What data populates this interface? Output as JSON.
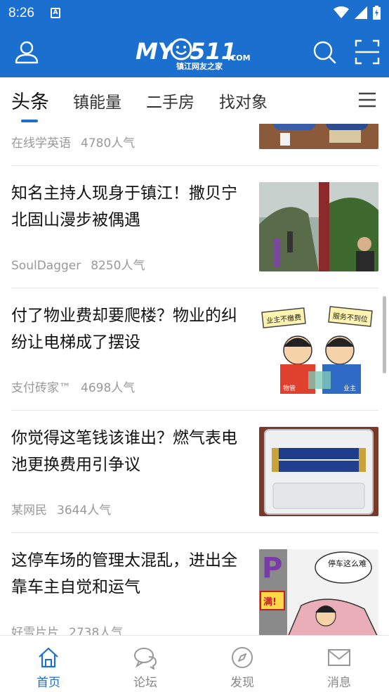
{
  "status_bar": {
    "time": "8:26",
    "notif_letter": "A"
  },
  "header": {
    "logo_main": "MY0511",
    "logo_com": ".COM",
    "logo_sub": "镇江网友之家",
    "profile_icon": "user-icon",
    "search_icon": "search-icon",
    "scan_icon": "scan-icon"
  },
  "tabs": [
    {
      "label": "头条",
      "active": true
    },
    {
      "label": "镇能量"
    },
    {
      "label": "二手房"
    },
    {
      "label": "找对象"
    }
  ],
  "feed": [
    {
      "title": "",
      "author": "在线学英语",
      "popularity": "4780人气",
      "image": "people-at-counter"
    },
    {
      "title": "知名主持人现身于镇江！撒贝宁北固山漫步被偶遇",
      "author": "SoulDagger",
      "popularity": "8250人气",
      "image": "man-on-path"
    },
    {
      "title": "付了物业费却要爬楼？物业的纠纷让电梯成了摆设",
      "author": "支付砖家™",
      "popularity": "4698人气",
      "image": "cartoon-dispute",
      "image_signs": [
        "业主不缴费",
        "服务不到位"
      ],
      "image_shirts": [
        "物管",
        "业主"
      ]
    },
    {
      "title": "你觉得这笔钱该谁出？燃气表电池更换费用引争议",
      "author": "某网民",
      "popularity": "3644人气",
      "image": "battery-box"
    },
    {
      "title": "这停车场的管理太混乱，进出全靠车主自觉和运气",
      "author": "好雪片片",
      "popularity": "2738人气",
      "image": "cartoon-parking",
      "image_bubble": "停车这么难",
      "image_sign": "满!"
    }
  ],
  "bottom_nav": [
    {
      "label": "首页",
      "icon": "home-icon",
      "active": true
    },
    {
      "label": "论坛",
      "icon": "chat-bubbles-icon"
    },
    {
      "label": "发现",
      "icon": "compass-icon"
    },
    {
      "label": "消息",
      "icon": "mail-icon"
    }
  ],
  "colors": {
    "brand": "#1a6fcf",
    "meta": "#999999",
    "text": "#111111"
  }
}
